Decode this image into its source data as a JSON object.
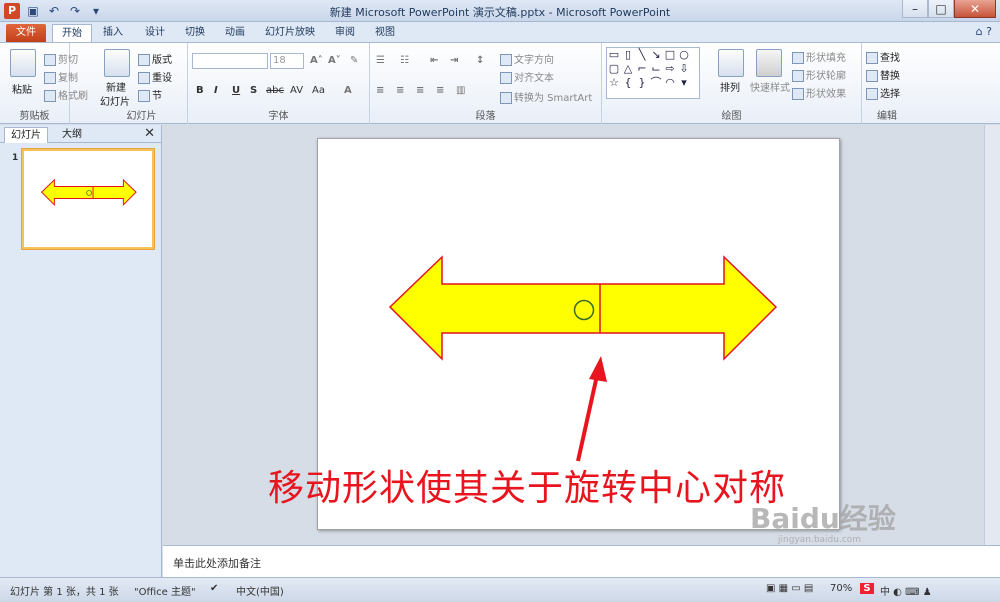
{
  "app": {
    "title": "新建 Microsoft PowerPoint 演示文稿.pptx - Microsoft PowerPoint",
    "icon_letter": "P"
  },
  "tabs": {
    "file": "文件",
    "home": "开始",
    "insert": "插入",
    "design": "设计",
    "transitions": "切换",
    "animations": "动画",
    "slideshow": "幻灯片放映",
    "review": "审阅",
    "view": "视图"
  },
  "ribbon": {
    "clipboard": {
      "label": "剪贴板",
      "paste": "粘贴",
      "cut": "剪切",
      "copy": "复制",
      "format_painter": "格式刷"
    },
    "slides": {
      "label": "幻灯片",
      "new_slide_1": "新建",
      "new_slide_2": "幻灯片",
      "layout": "版式",
      "reset": "重设",
      "section": "节"
    },
    "font": {
      "label": "字体",
      "size_value": "18",
      "bold": "B",
      "italic": "I",
      "underline": "U",
      "shadow": "S",
      "strike": "abc",
      "aa": "Aa"
    },
    "paragraph": {
      "label": "段落",
      "text_direction": "文字方向",
      "align_text": "对齐文本",
      "smartart": "转换为 SmartArt"
    },
    "drawing": {
      "label": "绘图",
      "arrange": "排列",
      "quick_styles": "快速样式",
      "shape_fill": "形状填充",
      "shape_outline": "形状轮廓",
      "shape_effects": "形状效果"
    },
    "editing": {
      "label": "编辑",
      "find": "查找",
      "replace": "替换",
      "select": "选择"
    }
  },
  "left_panel": {
    "tab_slides": "幻灯片",
    "tab_outline": "大纲",
    "slide_number": "1"
  },
  "slide": {
    "annotation": "移动形状使其关于旋转中心对称"
  },
  "notes": {
    "placeholder": "单击此处添加备注"
  },
  "status": {
    "slide_info": "幻灯片 第 1 张，共 1 张",
    "theme": "\"Office 主题\"",
    "language": "中文(中国)",
    "zoom": "70%"
  },
  "watermark": {
    "brand": "Baidu经验",
    "url": "jingyan.baidu.com"
  },
  "colors": {
    "arrow_fill": "#ffff00",
    "arrow_stroke": "#e0141e",
    "annotation": "#e8141e",
    "file_tab": "#d24726"
  }
}
